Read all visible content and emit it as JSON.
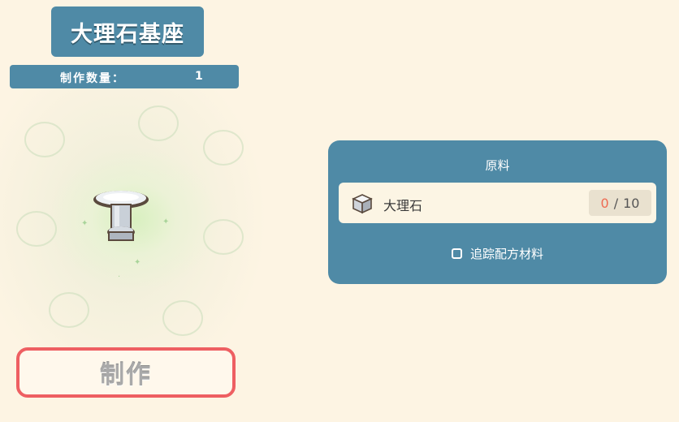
{
  "item": {
    "name": "大理石基座",
    "quantity_label": "制作数量：",
    "quantity": "1"
  },
  "craft_button": {
    "label": "制作"
  },
  "materials_panel": {
    "title": "原料",
    "materials": [
      {
        "icon": "marble-block-icon",
        "name": "大理石",
        "have": "0",
        "separator": "/",
        "need": "10"
      }
    ],
    "track_label": "追踪配方材料",
    "track_checked": false
  },
  "colors": {
    "panel": "#4f8aa6",
    "background": "#fdf4e3",
    "craft_border": "#ee5f62",
    "insufficient": "#ee6b52"
  }
}
